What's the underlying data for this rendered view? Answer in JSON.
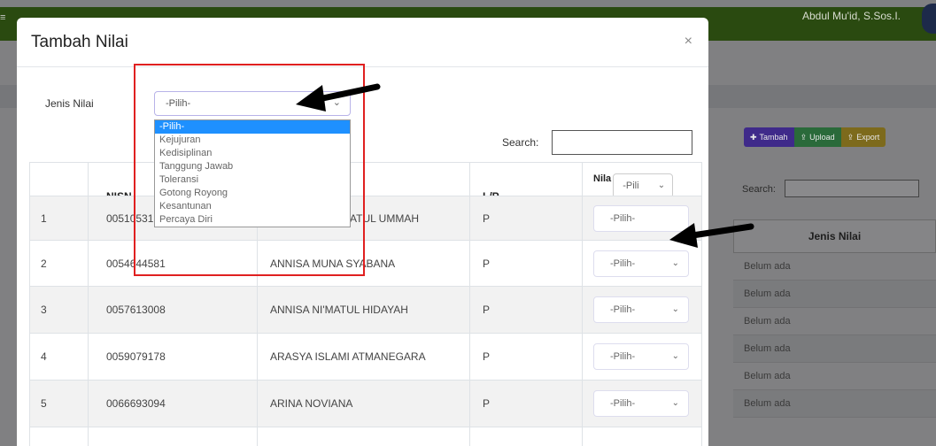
{
  "background": {
    "user_name": "Abdul Mu'id, S.Sos.I.",
    "buttons": {
      "tambah": "Tambah",
      "upload": "Upload",
      "export": "Export"
    },
    "search_label": "Search:",
    "table": {
      "header": "Jenis Nilai",
      "rows": [
        "Belum ada",
        "Belum ada",
        "Belum ada",
        "Belum ada",
        "Belum ada",
        "Belum ada"
      ]
    }
  },
  "modal": {
    "title": "Tambah Nilai",
    "close": "×",
    "jenis_label": "Jenis Nilai",
    "jenis_select_value": "-Pilih-",
    "search_label": "Search:",
    "dropdown_options": [
      "-Pilih-",
      "Kejujuran",
      "Kedisiplinan",
      "Tanggung Jawab",
      "Toleransi",
      "Gotong Royong",
      "Kesantunan",
      "Percaya Diri"
    ],
    "table": {
      "headers": {
        "no": "",
        "nisn": "NISN",
        "nama": "",
        "lp": "L/P",
        "nilai": "Nila"
      },
      "header_select": "-Pili",
      "rows": [
        {
          "no": "1",
          "nisn": "00510531",
          "nama": "ATUL UMMAH",
          "lp": "P",
          "nilai": "-Pilih-"
        },
        {
          "no": "2",
          "nisn": "0054644581",
          "nama": "ANNISA MUNA SYABANA",
          "lp": "P",
          "nilai": "-Pilih-"
        },
        {
          "no": "3",
          "nisn": "0057613008",
          "nama": "ANNISA NI'MATUL HIDAYAH",
          "lp": "P",
          "nilai": "-Pilih-"
        },
        {
          "no": "4",
          "nisn": "0059079178",
          "nama": "ARASYA ISLAMI ATMANEGARA",
          "lp": "P",
          "nilai": "-Pilih-"
        },
        {
          "no": "5",
          "nisn": "0066693094",
          "nama": "ARINA NOVIANA",
          "lp": "P",
          "nilai": "-Pilih-"
        }
      ]
    }
  },
  "colors": {
    "highlight_box": "#e02020",
    "selected_option": "#1e90ff"
  }
}
